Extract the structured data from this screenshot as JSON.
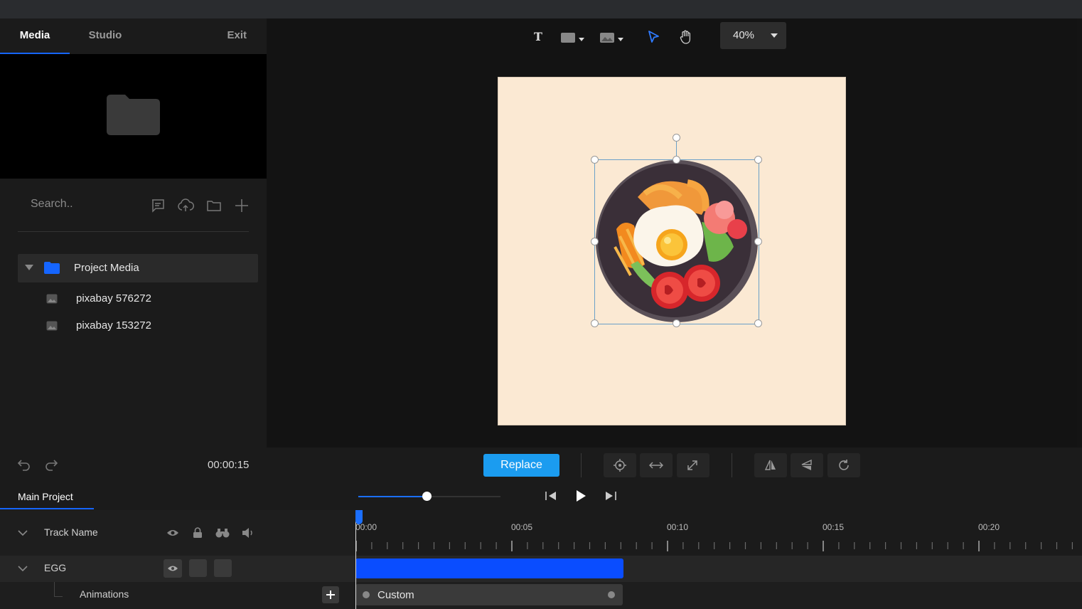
{
  "tabs": {
    "media": "Media",
    "studio": "Studio",
    "exit": "Exit"
  },
  "search": {
    "placeholder": "Search.."
  },
  "media_tree": {
    "folder": "Project Media",
    "items": [
      "pixabay 576272",
      "pixabay 153272"
    ]
  },
  "toolbar": {
    "zoom": "40%"
  },
  "controls": {
    "current_time": "00:00:15",
    "replace_label": "Replace"
  },
  "timeline": {
    "project_tab": "Main Project",
    "track_header": "Track Name",
    "track_name": "EGG",
    "animations_label": "Animations",
    "animation_clip": "Custom",
    "ruler_labels": [
      "00:00",
      "00:05",
      "00:10",
      "00:15",
      "00:20"
    ],
    "seek_position": 0.48
  },
  "colors": {
    "accent": "#1565ff",
    "replace": "#1b9cf0",
    "clip": "#0a4dff",
    "canvas": "#fbe9d3"
  },
  "icons": [
    "text-tool-icon",
    "shape-tool-icon",
    "image-tool-icon",
    "select-tool-icon",
    "hand-tool-icon",
    "folder-icon",
    "comment-icon",
    "upload-icon",
    "folder-outline-icon",
    "plus-icon",
    "undo-icon",
    "redo-icon",
    "target-icon",
    "swap-horizontal-icon",
    "resize-icon",
    "flip-horizontal-icon",
    "flip-vertical-icon",
    "rotate-icon",
    "skip-back-icon",
    "play-icon",
    "skip-forward-icon",
    "eye-icon",
    "lock-icon",
    "binoculars-icon",
    "speaker-icon"
  ]
}
